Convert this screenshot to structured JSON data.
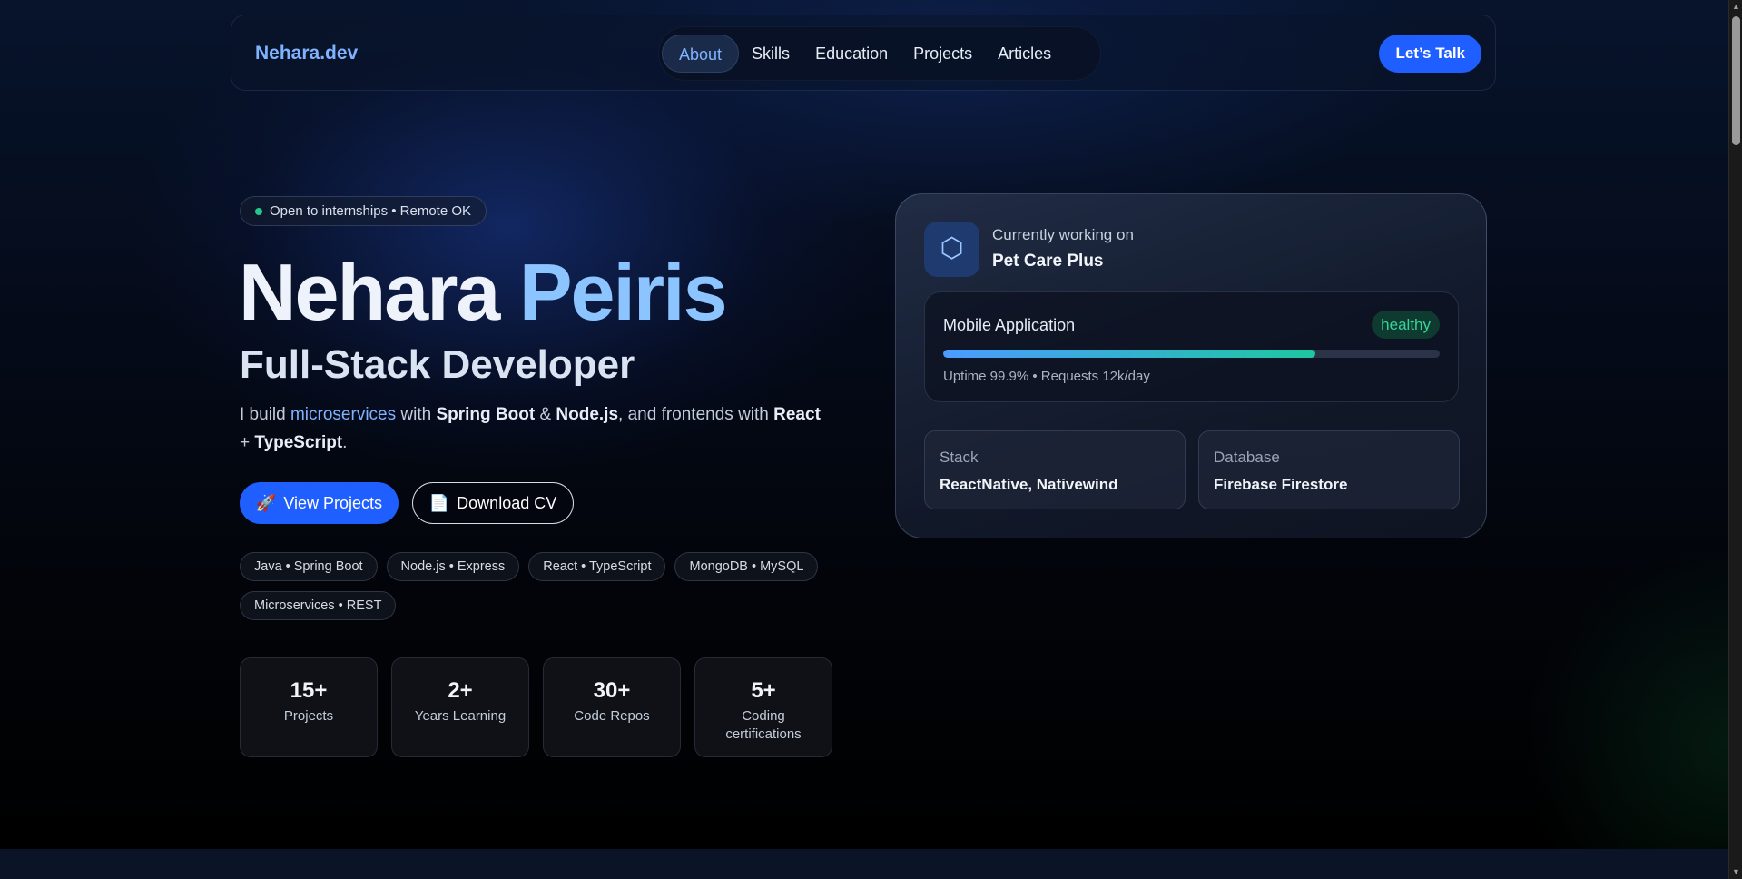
{
  "nav": {
    "brand": "Nehara.dev",
    "items": [
      {
        "label": "About",
        "active": true
      },
      {
        "label": "Skills",
        "active": false
      },
      {
        "label": "Education",
        "active": false
      },
      {
        "label": "Projects",
        "active": false
      },
      {
        "label": "Articles",
        "active": false
      }
    ],
    "cta": "Let’s Talk"
  },
  "hero": {
    "status_badge": "Open to internships • Remote OK",
    "name_first": "Nehara",
    "name_last": "Peiris",
    "role": "Full-Stack Developer",
    "description": {
      "p1": "I build ",
      "hl": "microservices",
      "p2": " with ",
      "b1": "Spring Boot",
      "p3": " & ",
      "b2": "Node.js",
      "p4": ", and frontends with ",
      "b3": "React",
      "p5": " + ",
      "b4": "TypeScript",
      "p6": "."
    },
    "primary_button": {
      "icon": "rocket-icon",
      "glyph": "🚀",
      "label": "View Projects"
    },
    "secondary_button": {
      "icon": "document-icon",
      "glyph": "📄",
      "label": "Download CV"
    },
    "tags": [
      "Java • Spring Boot",
      "Node.js • Express",
      "React • TypeScript",
      "MongoDB • MySQL",
      "Microservices • REST"
    ],
    "stats": [
      {
        "value": "15+",
        "label": "Projects"
      },
      {
        "value": "2+",
        "label": "Years Learning"
      },
      {
        "value": "30+",
        "label": "Code Repos"
      },
      {
        "value": "5+",
        "label": "Coding certifications"
      }
    ]
  },
  "card": {
    "icon": "hexagon-icon",
    "icon_glyph": "⬡",
    "working_label": "Currently working on",
    "project_name": "Pet Care Plus",
    "app": {
      "title": "Mobile Application",
      "status": "healthy",
      "progress": 0.75,
      "metrics": "Uptime 99.9% • Requests 12k/day"
    },
    "stack": {
      "label": "Stack",
      "value": "ReactNative, Nativewind"
    },
    "database": {
      "label": "Database",
      "value": "Firebase Firestore"
    }
  },
  "colors": {
    "accent": "#1f5eff",
    "brand_text": "#7fb2ff",
    "healthy": "#36d39a",
    "status_dot": "#22c98a"
  }
}
